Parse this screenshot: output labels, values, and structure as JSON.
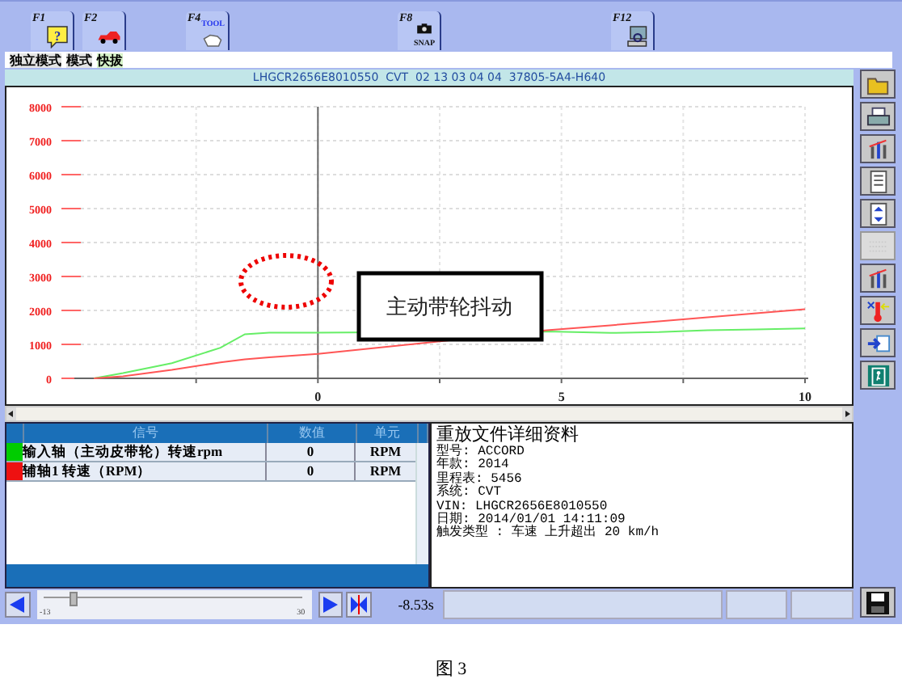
{
  "function_keys": [
    {
      "key": "F1",
      "badge": "?"
    },
    {
      "key": "F2"
    },
    {
      "key": "F4",
      "badge": "TOOL"
    },
    {
      "key": "F8",
      "badge": "SNAP"
    },
    {
      "key": "F12"
    }
  ],
  "modes": [
    {
      "label": "独立模式",
      "selected": false
    },
    {
      "label": "模式",
      "selected": false
    },
    {
      "label": "快拔",
      "selected": true
    }
  ],
  "header": "LHGCR2656E8010550  CVT  02 13 03 04 04  37805-5A4-H640",
  "chart": {
    "chart_data": {
      "type": "line",
      "x": [
        -4.6,
        -4,
        -3,
        -2,
        -1.5,
        -1,
        0,
        4.7,
        6,
        7,
        8,
        9,
        10
      ],
      "series": [
        {
          "name": "输入轴（主动皮带轮）转速rpm",
          "color": "#66ee66",
          "values": [
            0,
            150,
            450,
            900,
            1300,
            1350,
            1350,
            1380,
            1340,
            1360,
            1420,
            1440,
            1470
          ]
        },
        {
          "name": "辅轴1 转速（RPM）",
          "color": "#ff5555",
          "values": [
            0,
            60,
            250,
            470,
            560,
            620,
            720,
            1420,
            1560,
            1680,
            1800,
            1920,
            2040
          ]
        }
      ],
      "grid": true,
      "xlim": [
        -5,
        10
      ],
      "ylim": [
        0,
        8000
      ],
      "xticks": [
        0,
        5,
        10
      ],
      "yticks": [
        0,
        1000,
        2000,
        3000,
        4000,
        5000,
        6000,
        7000,
        8000
      ],
      "annotations": [
        {
          "text": "主动带轮抖动"
        }
      ]
    }
  },
  "side_tools": [
    {
      "disabled": false
    },
    {
      "disabled": false
    },
    {
      "disabled": false
    },
    {
      "disabled": false
    },
    {
      "disabled": false
    },
    {
      "disabled": true
    },
    {
      "disabled": false
    },
    {
      "disabled": false
    },
    {
      "disabled": false
    },
    {
      "disabled": false
    }
  ],
  "table": {
    "columns": [
      "信号",
      "数值",
      "单元"
    ],
    "rows": [
      {
        "color": "#00cc00",
        "value": "0",
        "unit": "RPM"
      },
      {
        "color": "#ee1111",
        "value": "0",
        "unit": "RPM"
      }
    ]
  },
  "details": {
    "title": "重放文件详细资料",
    "lines": [
      "型号: ACCORD",
      "年款: 2014",
      "里程表:  5456",
      "系统: CVT",
      "VIN: LHGCR2656E8010550",
      "日期: 2014/01/01 14:11:09",
      "触发类型 : 车速 上升超出 20 km/h"
    ]
  },
  "playback": {
    "min_label": "-13",
    "max_label": "30",
    "level": 0.1,
    "time": "-8.53s"
  },
  "caption": "图 3"
}
